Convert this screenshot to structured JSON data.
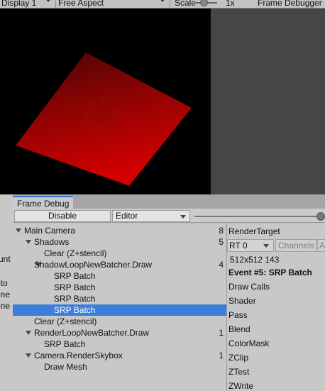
{
  "game_toolbar": {
    "display": "Display 1",
    "aspect": "Free Aspect",
    "scale_label": "Scale",
    "scale_value": "1x",
    "right_tab": "Frame Debugger"
  },
  "left_strip": [
    "unt",
    "ito",
    "ine",
    "ine"
  ],
  "frame_debug": {
    "tab": "Frame Debug",
    "disable_button": "Disable",
    "target_dropdown": "Editor",
    "event_slider_value": 1.0,
    "tree": [
      {
        "label": "Main Camera",
        "count": "8",
        "expanded": true,
        "selected": false
      },
      {
        "label": "Shadows",
        "count": "5",
        "expanded": true,
        "selected": false
      },
      {
        "label": "Clear (Z+stencil)",
        "count": "",
        "selected": false
      },
      {
        "label": "ShadowLoopNewBatcher.Draw",
        "count": "4",
        "expanded": true,
        "selected": false
      },
      {
        "label": "SRP Batch",
        "count": "",
        "selected": false
      },
      {
        "label": "SRP Batch",
        "count": "",
        "selected": false
      },
      {
        "label": "SRP Batch",
        "count": "",
        "selected": false
      },
      {
        "label": "SRP Batch",
        "count": "",
        "selected": true
      },
      {
        "label": "Clear (Z+stencil)",
        "count": "",
        "selected": false
      },
      {
        "label": "RenderLoopNewBatcher.Draw",
        "count": "1",
        "expanded": true,
        "selected": false
      },
      {
        "label": "SRP Batch",
        "count": "",
        "selected": false
      },
      {
        "label": "Camera.RenderSkybox",
        "count": "1",
        "expanded": true,
        "selected": false
      },
      {
        "label": "Draw Mesh",
        "count": "",
        "selected": false
      }
    ],
    "details": {
      "render_target_label": "RenderTarget",
      "rt_dropdown": "RT 0",
      "channels_label": "Channels",
      "channel_a": "A",
      "size_info": "512x512 143",
      "event_title": "Event #5: SRP Batch",
      "properties": [
        "Draw Calls",
        "Shader",
        "Pass",
        "Blend",
        "ColorMask",
        "ZClip",
        "ZTest",
        "ZWrite"
      ]
    }
  },
  "colors": {
    "selection": "#3d7ddc",
    "tab_accent": "#3a72d6",
    "plane_red": "#c40000"
  }
}
